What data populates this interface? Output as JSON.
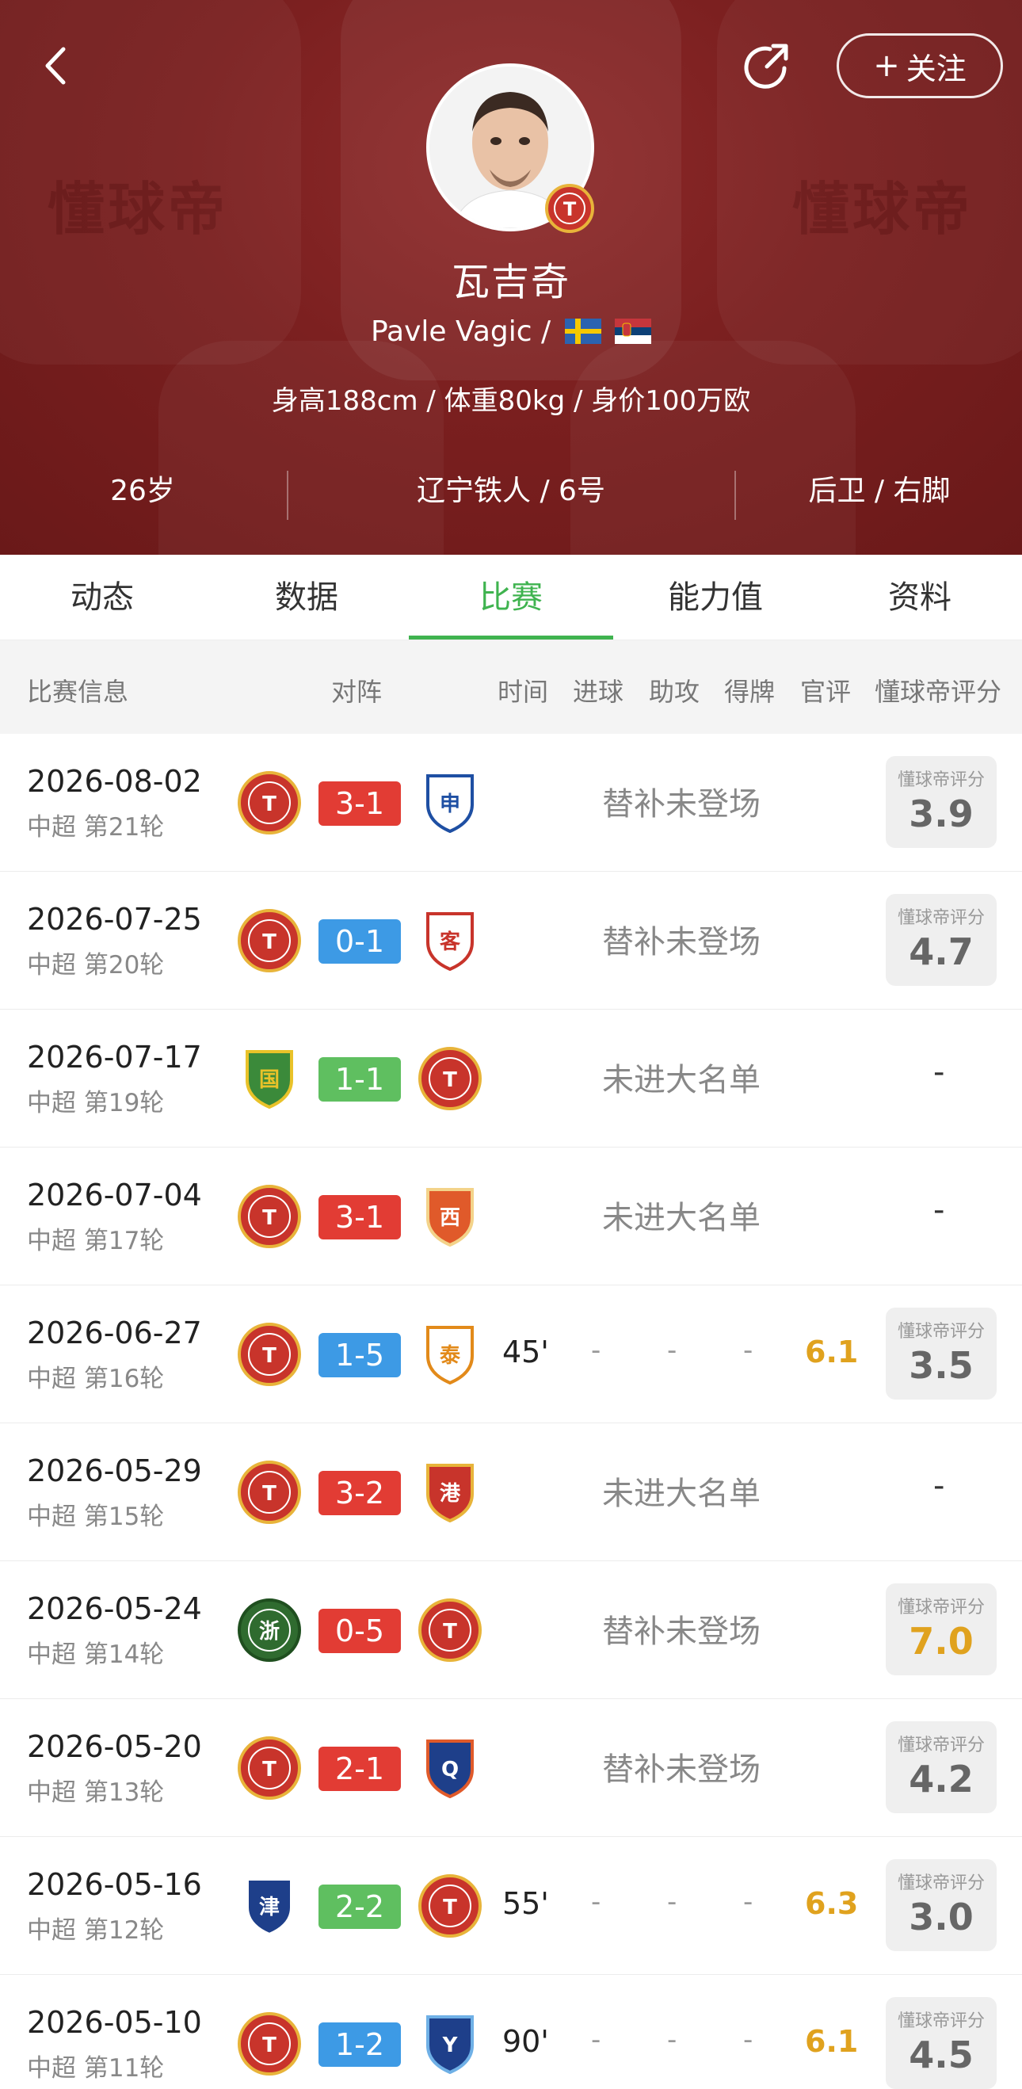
{
  "header": {
    "watermark": "懂球帝",
    "follow_label": "关注",
    "player_name": "瓦吉奇",
    "player_en": "Pavle Vagic /",
    "player_body": "身高188cm / 体重80kg / 身价100万欧",
    "age": "26岁",
    "club_number": "辽宁铁人 / 6号",
    "position_foot": "后卫 / 右脚",
    "icons": [
      "back-arrow-icon",
      "share-icon",
      "plus-icon",
      "sweden-flag-icon",
      "serbia-flag-icon",
      "club-badge-icon"
    ]
  },
  "tabs": [
    "动态",
    "数据",
    "比赛",
    "能力值",
    "资料"
  ],
  "active_tab": "比赛",
  "columns": {
    "match_info": "比赛信息",
    "matchup": "对阵",
    "time": "时间",
    "goals": "进球",
    "assists": "助攻",
    "cards": "得牌",
    "official": "官评",
    "dqd_rating": "懂球帝评分"
  },
  "rating_label": "懂球帝评分",
  "matches": [
    {
      "date": "2026-08-02",
      "round": "中超 第21轮",
      "score": "3-1",
      "result": "win",
      "home": "liaoning-tieren",
      "away": "shanghai-shenhua",
      "status": "替补未登场",
      "time": "",
      "goals": "",
      "assists": "",
      "cards": "",
      "official": "",
      "dqd": "3.9"
    },
    {
      "date": "2026-07-25",
      "round": "中超 第20轮",
      "score": "0-1",
      "result": "loss",
      "home": "liaoning-tieren",
      "away": "meizhou-hakka",
      "status": "替补未登场",
      "time": "",
      "goals": "",
      "assists": "",
      "cards": "",
      "official": "",
      "dqd": "4.7"
    },
    {
      "date": "2026-07-17",
      "round": "中超 第19轮",
      "score": "1-1",
      "result": "draw",
      "home": "beijing-guoan",
      "away": "liaoning-tieren",
      "status": "未进大名单",
      "time": "",
      "goals": "",
      "assists": "",
      "cards": "",
      "official": "",
      "dqd": "-"
    },
    {
      "date": "2026-07-04",
      "round": "中超 第17轮",
      "score": "3-1",
      "result": "win",
      "home": "liaoning-tieren",
      "away": "qingdao-west-coast",
      "status": "未进大名单",
      "time": "",
      "goals": "",
      "assists": "",
      "cards": "",
      "official": "",
      "dqd": "-"
    },
    {
      "date": "2026-06-27",
      "round": "中超 第16轮",
      "score": "1-5",
      "result": "loss",
      "home": "liaoning-tieren",
      "away": "shandong-taishan",
      "status": "",
      "time": "45'",
      "goals": "-",
      "assists": "-",
      "cards": "-",
      "official": "6.1",
      "dqd": "3.5"
    },
    {
      "date": "2026-05-29",
      "round": "中超 第15轮",
      "score": "3-2",
      "result": "win",
      "home": "liaoning-tieren",
      "away": "shanghai-port",
      "status": "未进大名单",
      "time": "",
      "goals": "",
      "assists": "",
      "cards": "",
      "official": "",
      "dqd": "-"
    },
    {
      "date": "2026-05-24",
      "round": "中超 第14轮",
      "score": "0-5",
      "result": "win",
      "home": "zhejiang",
      "away": "liaoning-tieren",
      "status": "替补未登场",
      "time": "",
      "goals": "",
      "assists": "",
      "cards": "",
      "official": "",
      "dqd": "7.0"
    },
    {
      "date": "2026-05-20",
      "round": "中超 第13轮",
      "score": "2-1",
      "result": "win",
      "home": "liaoning-tieren",
      "away": "qingdao-hainiu",
      "status": "替补未登场",
      "time": "",
      "goals": "",
      "assists": "",
      "cards": "",
      "official": "",
      "dqd": "4.2"
    },
    {
      "date": "2026-05-16",
      "round": "中超 第12轮",
      "score": "2-2",
      "result": "draw",
      "home": "tianjin-tigers",
      "away": "liaoning-tieren",
      "status": "",
      "time": "55'",
      "goals": "-",
      "assists": "-",
      "cards": "-",
      "official": "6.3",
      "dqd": "3.0"
    },
    {
      "date": "2026-05-10",
      "round": "中超 第11轮",
      "score": "1-2",
      "result": "loss",
      "home": "liaoning-tieren",
      "away": "yunnan-yukun",
      "status": "",
      "time": "90'",
      "goals": "-",
      "assists": "-",
      "cards": "-",
      "official": "6.1",
      "dqd": "4.5"
    }
  ],
  "colors": {
    "header_bg": "#7a1f1f",
    "accent_green": "#3fb34f",
    "win_red": "#e23c34",
    "loss_blue": "#3d9ae5",
    "draw_green": "#5fbf60",
    "rating_gold": "#e0a21e"
  }
}
